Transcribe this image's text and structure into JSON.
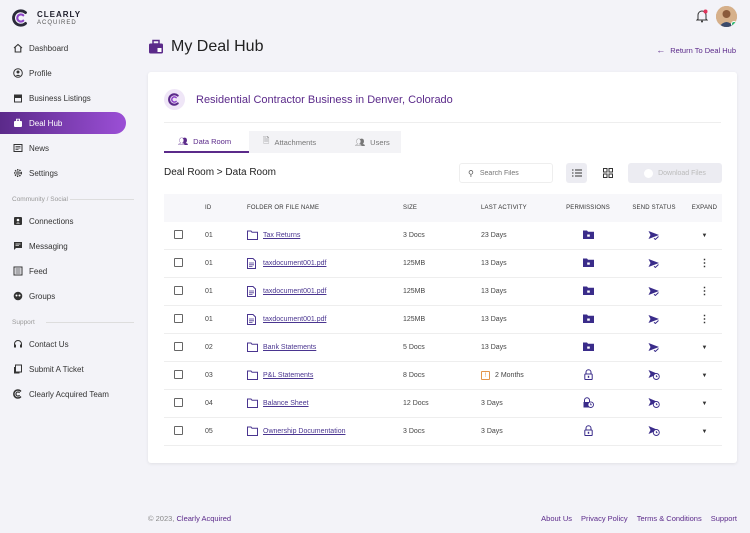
{
  "brand": {
    "line1": "CLEARLY",
    "line2": "ACQUIRED"
  },
  "sidebar": {
    "items": [
      {
        "label": "Dashboard",
        "icon": "home-icon"
      },
      {
        "label": "Profile",
        "icon": "user-icon"
      },
      {
        "label": "Business Listings",
        "icon": "store-icon"
      },
      {
        "label": "Deal Hub",
        "icon": "briefcase-icon",
        "active": true
      },
      {
        "label": "News",
        "icon": "news-icon"
      },
      {
        "label": "Settings",
        "icon": "gear-icon"
      }
    ],
    "section_community": "Community / Social",
    "community_items": [
      {
        "label": "Connections",
        "icon": "connections-icon"
      },
      {
        "label": "Messaging",
        "icon": "message-icon"
      },
      {
        "label": "Feed",
        "icon": "feed-icon"
      },
      {
        "label": "Groups",
        "icon": "groups-icon"
      }
    ],
    "section_support": "Support",
    "support_items": [
      {
        "label": "Contact Us",
        "icon": "headset-icon"
      },
      {
        "label": "Submit A Ticket",
        "icon": "ticket-icon"
      },
      {
        "label": "Clearly Acquired Team",
        "icon": "logo-icon"
      }
    ]
  },
  "header": {
    "title": "My Deal Hub",
    "return_label": "Return To Deal Hub"
  },
  "business": {
    "title": "Residential Contractor Business in Denver, Colorado"
  },
  "tabs": [
    {
      "label": "Data Room",
      "active": true
    },
    {
      "label": "Attachments"
    },
    {
      "label": "Users"
    }
  ],
  "breadcrumb": "Deal Room > Data Room",
  "search": {
    "placeholder": "Search Files"
  },
  "download_label": "Download Files",
  "table": {
    "headers": {
      "id": "ID",
      "name": "FOLDER OR FILE NAME",
      "size": "SIZE",
      "activity": "LAST ACTIVITY",
      "permissions": "PERMISSIONS",
      "send": "SEND STATUS",
      "expand": "EXPAND"
    },
    "rows": [
      {
        "id": "01",
        "name": "Tax Returns",
        "type": "folder",
        "size": "3 Docs",
        "activity": "23 Days",
        "warn": false,
        "perm": "folder-lock",
        "send": "sent",
        "expand": "caret"
      },
      {
        "id": "01",
        "name": "taxdocument001.pdf",
        "type": "file",
        "size": "125MB",
        "activity": "13 Days",
        "warn": false,
        "perm": "folder-lock",
        "send": "sent",
        "expand": "dots"
      },
      {
        "id": "01",
        "name": "taxdocument001.pdf",
        "type": "file",
        "size": "125MB",
        "activity": "13 Days",
        "warn": false,
        "perm": "folder-lock",
        "send": "sent",
        "expand": "dots"
      },
      {
        "id": "01",
        "name": "taxdocument001.pdf",
        "type": "file",
        "size": "125MB",
        "activity": "13 Days",
        "warn": false,
        "perm": "folder-lock",
        "send": "sent",
        "expand": "dots"
      },
      {
        "id": "02",
        "name": "Bank Statements",
        "type": "folder",
        "size": "5 Docs",
        "activity": "13 Days",
        "warn": false,
        "perm": "folder-lock",
        "send": "sent",
        "expand": "caret"
      },
      {
        "id": "03",
        "name": "P&L Statements",
        "type": "folder",
        "size": "8 Docs",
        "activity": "2 Months",
        "warn": true,
        "perm": "lock",
        "send": "pending",
        "expand": "caret"
      },
      {
        "id": "04",
        "name": "Balance Sheet",
        "type": "folder",
        "size": "12 Docs",
        "activity": "3 Days",
        "warn": false,
        "perm": "lock-clock",
        "send": "pending",
        "expand": "caret"
      },
      {
        "id": "05",
        "name": "Ownership Documentation",
        "type": "folder",
        "size": "3 Docs",
        "activity": "3 Days",
        "warn": false,
        "perm": "lock",
        "send": "pending",
        "expand": "caret"
      }
    ]
  },
  "footer": {
    "copyright_prefix": "© 2023,",
    "copyright_brand": "Clearly Acquired",
    "links": [
      "About Us",
      "Privacy Policy",
      "Terms & Conditions",
      "Support"
    ]
  },
  "colors": {
    "accent": "#5b2a8a",
    "accent_light": "#9b4fd6",
    "link": "#4a3590",
    "warn": "#e4954a"
  }
}
